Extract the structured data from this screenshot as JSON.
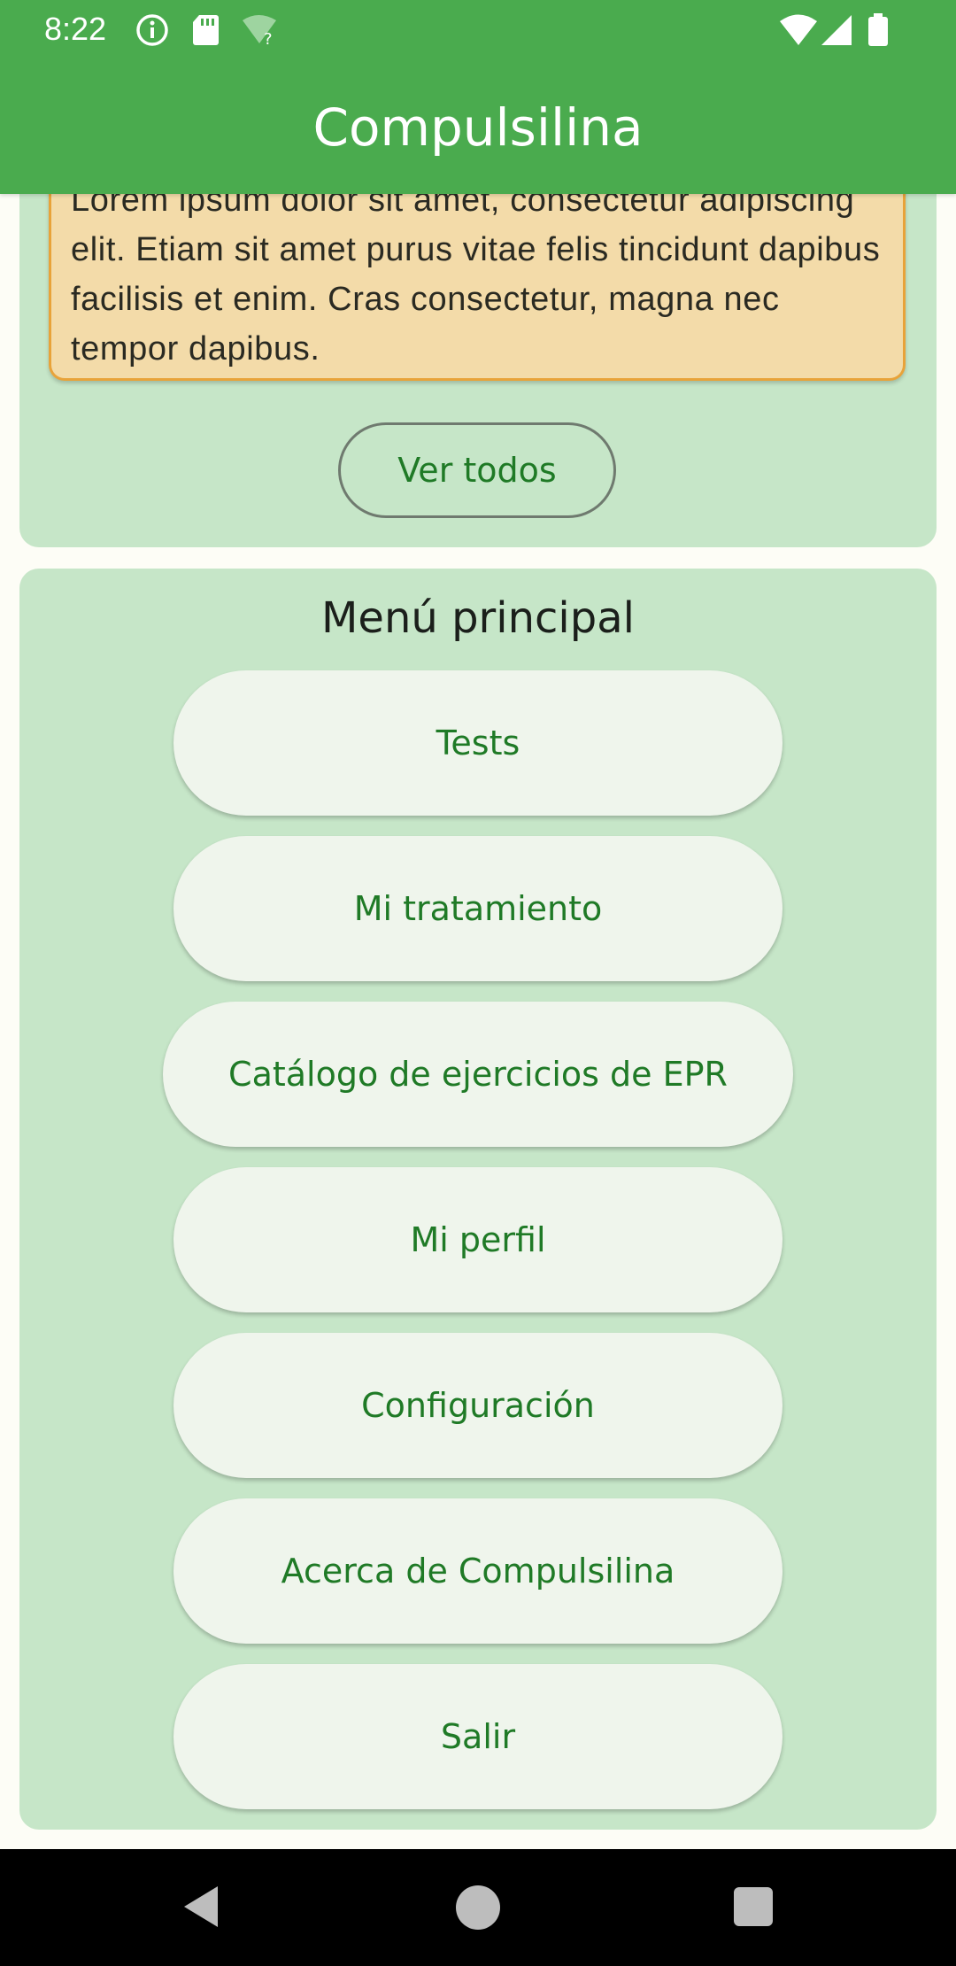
{
  "status_bar": {
    "time": "8:22",
    "left_icons": [
      "info-icon",
      "sd-card-icon",
      "wifi-unknown-icon"
    ],
    "right_icons": [
      "wifi-icon",
      "signal-icon",
      "battery-icon"
    ],
    "wifi_unknown_mark": "?"
  },
  "app_bar": {
    "title": "Compulsilina"
  },
  "notice": {
    "text": "Lorem ipsum dolor sit amet, consectetur adipiscing elit. Etiam sit amet purus vitae felis tincidunt dapibus facilisis et enim. Cras consectetur, magna nec tempor dapibus."
  },
  "see_all_label": "Ver todos",
  "main_menu": {
    "title": "Menú principal",
    "items": [
      {
        "label": "Tests"
      },
      {
        "label": "Mi tratamiento"
      },
      {
        "label": "Catálogo de ejercicios de EPR"
      },
      {
        "label": "Mi perfil"
      },
      {
        "label": "Configuración"
      },
      {
        "label": "Acerca de Compulsilina"
      },
      {
        "label": "Salir"
      }
    ]
  },
  "nav_bar": {
    "icons": [
      "back-icon",
      "home-icon",
      "recents-icon"
    ]
  },
  "colors": {
    "primary": "#4aab4e",
    "card": "#c6e6c8",
    "button": "#eff5ec",
    "button_text": "#1f7a26",
    "notice_bg": "#f3dba9",
    "notice_border": "#e8a33a"
  }
}
